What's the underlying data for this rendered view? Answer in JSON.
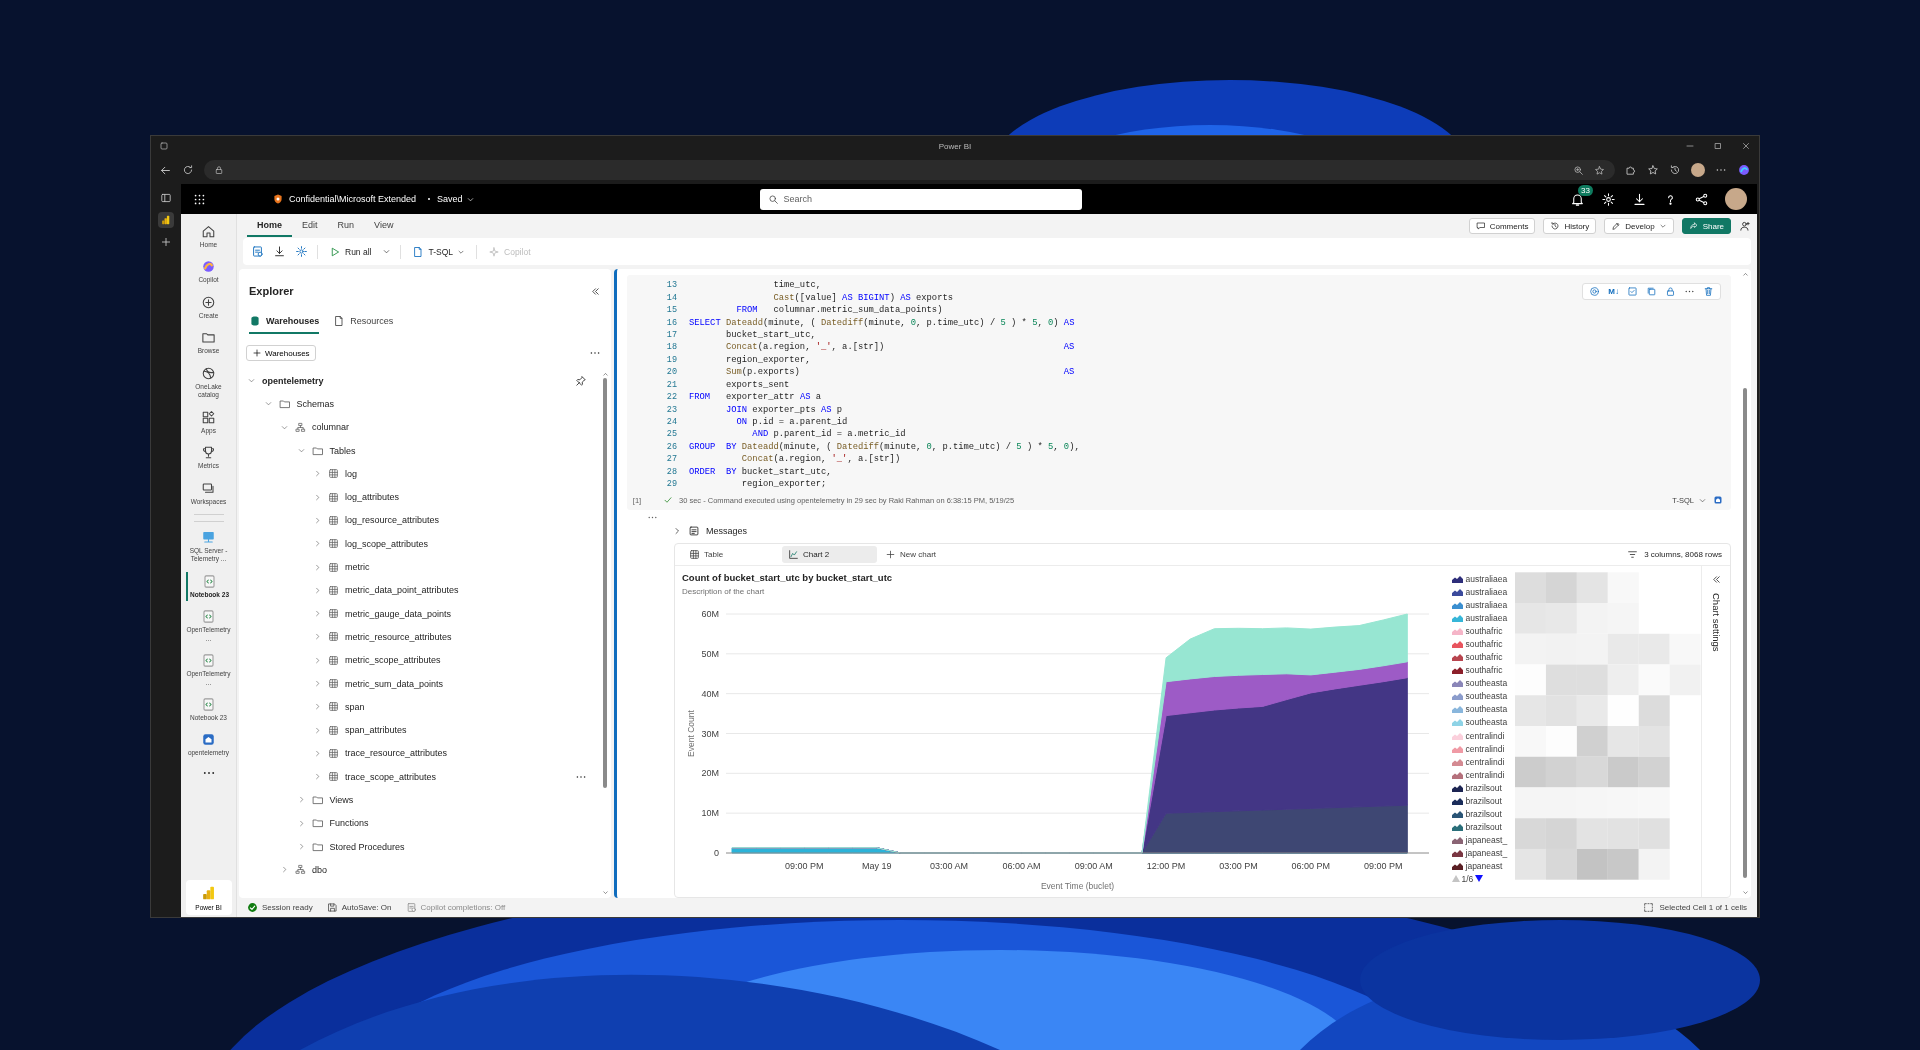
{
  "browser": {
    "title": "Power BI"
  },
  "app_header": {
    "breadcrumb": "Confidential\\Microsoft Extended",
    "save_state": "Saved",
    "search": {
      "placeholder": "Search"
    },
    "notification_count": "33"
  },
  "nav_rail": [
    {
      "label": "Home",
      "selected": false
    },
    {
      "label": "Copilot",
      "selected": false
    },
    {
      "label": "Create",
      "selected": false
    },
    {
      "label": "Browse",
      "selected": false
    },
    {
      "label": "OneLake catalog",
      "selected": false
    },
    {
      "label": "Apps",
      "selected": false
    },
    {
      "label": "Metrics",
      "selected": false
    },
    {
      "label": "Workspaces",
      "selected": false
    },
    {
      "label": "SQL Server - Telemetry ...",
      "selected": false
    },
    {
      "label": "Notebook 23",
      "selected": true
    },
    {
      "label": "OpenTelemetry ...",
      "selected": false
    },
    {
      "label": "OpenTelemetry ...",
      "selected": false
    },
    {
      "label": "Notebook 23",
      "selected": false
    },
    {
      "label": "opentelemetry",
      "selected": false
    }
  ],
  "workload_switcher": "Power BI",
  "ribbon": {
    "tabs": [
      {
        "label": "Home",
        "selected": true
      },
      {
        "label": "Edit",
        "selected": false
      },
      {
        "label": "Run",
        "selected": false
      },
      {
        "label": "View",
        "selected": false
      }
    ],
    "actions": [
      {
        "label": "Comments",
        "kind": "plain"
      },
      {
        "label": "History",
        "kind": "plain"
      },
      {
        "label": "Develop",
        "kind": "dropdown"
      },
      {
        "label": "Share",
        "kind": "primary"
      }
    ]
  },
  "toolbar": {
    "run_all": "Run all",
    "language": "T-SQL",
    "copilot": {
      "label": "Copilot",
      "disabled": true
    }
  },
  "explorer": {
    "title": "Explorer",
    "tabs": [
      {
        "label": "Warehouses",
        "selected": true
      },
      {
        "label": "Resources",
        "selected": false
      }
    ],
    "add_button": "Warehouses",
    "tree": [
      {
        "label": "opentelemetry",
        "kind": "database",
        "expanded": true,
        "children": [
          {
            "label": "Schemas",
            "kind": "folder",
            "expanded": true,
            "children": [
              {
                "label": "columnar",
                "kind": "schema",
                "expanded": true,
                "children": [
                  {
                    "label": "Tables",
                    "kind": "folder",
                    "expanded": true,
                    "children": [
                      {
                        "label": "log",
                        "kind": "table",
                        "expanded": false,
                        "hovered": false
                      },
                      {
                        "label": "log_attributes",
                        "kind": "table",
                        "expanded": false,
                        "hovered": false
                      },
                      {
                        "label": "log_resource_attributes",
                        "kind": "table",
                        "expanded": false,
                        "hovered": false
                      },
                      {
                        "label": "log_scope_attributes",
                        "kind": "table",
                        "expanded": false,
                        "hovered": false
                      },
                      {
                        "label": "metric",
                        "kind": "table",
                        "expanded": false,
                        "hovered": false
                      },
                      {
                        "label": "metric_data_point_attributes",
                        "kind": "table",
                        "expanded": false,
                        "hovered": false
                      },
                      {
                        "label": "metric_gauge_data_points",
                        "kind": "table",
                        "expanded": false,
                        "hovered": false
                      },
                      {
                        "label": "metric_resource_attributes",
                        "kind": "table",
                        "expanded": false,
                        "hovered": false
                      },
                      {
                        "label": "metric_scope_attributes",
                        "kind": "table",
                        "expanded": false,
                        "hovered": false
                      },
                      {
                        "label": "metric_sum_data_points",
                        "kind": "table",
                        "expanded": false,
                        "hovered": false
                      },
                      {
                        "label": "span",
                        "kind": "table",
                        "expanded": false,
                        "hovered": false
                      },
                      {
                        "label": "span_attributes",
                        "kind": "table",
                        "expanded": false,
                        "hovered": false
                      },
                      {
                        "label": "trace_resource_attributes",
                        "kind": "table",
                        "expanded": false,
                        "hovered": false
                      },
                      {
                        "label": "trace_scope_attributes",
                        "kind": "table",
                        "expanded": false,
                        "hovered": true
                      }
                    ]
                  },
                  {
                    "label": "Views",
                    "kind": "folder",
                    "expanded": false
                  },
                  {
                    "label": "Functions",
                    "kind": "folder",
                    "expanded": false
                  },
                  {
                    "label": "Stored Procedures",
                    "kind": "folder",
                    "expanded": false
                  }
                ]
              },
              {
                "label": "dbo",
                "kind": "schema",
                "expanded": false
              }
            ]
          }
        ]
      }
    ]
  },
  "cell": {
    "execution_count": "[1]",
    "toolbar_label": "M↓",
    "lines": [
      {
        "number": "13",
        "tokens": [
          {
            "text": "                time_utc,",
            "kind": "plain"
          }
        ]
      },
      {
        "number": "14",
        "tokens": [
          {
            "text": "                Cast",
            "kind": "function"
          },
          {
            "text": "([value] ",
            "kind": "plain"
          },
          {
            "text": "AS BIGINT",
            "kind": "keyword"
          },
          {
            "text": ") ",
            "kind": "plain"
          },
          {
            "text": "AS",
            "kind": "keyword"
          },
          {
            "text": " exports",
            "kind": "plain"
          }
        ]
      },
      {
        "number": "15",
        "tokens": [
          {
            "text": "         FROM",
            "kind": "keyword"
          },
          {
            "text": "   columnar.metric_sum_data_points)",
            "kind": "plain"
          }
        ]
      },
      {
        "number": "16",
        "tokens": [
          {
            "text": "SELECT ",
            "kind": "keyword"
          },
          {
            "text": "Dateadd",
            "kind": "function"
          },
          {
            "text": "(minute, ( ",
            "kind": "plain"
          },
          {
            "text": "Datediff",
            "kind": "function"
          },
          {
            "text": "(minute, ",
            "kind": "plain"
          },
          {
            "text": "0",
            "kind": "number"
          },
          {
            "text": ", p.time_utc) / ",
            "kind": "plain"
          },
          {
            "text": "5",
            "kind": "number"
          },
          {
            "text": " ) * ",
            "kind": "plain"
          },
          {
            "text": "5",
            "kind": "number"
          },
          {
            "text": ", ",
            "kind": "plain"
          },
          {
            "text": "0",
            "kind": "number"
          },
          {
            "text": ") ",
            "kind": "plain"
          },
          {
            "text": "AS",
            "kind": "keyword"
          }
        ]
      },
      {
        "number": "17",
        "tokens": [
          {
            "text": "       bucket_start_utc,",
            "kind": "plain"
          }
        ]
      },
      {
        "number": "18",
        "tokens": [
          {
            "text": "       Concat",
            "kind": "function"
          },
          {
            "text": "(a.region, ",
            "kind": "plain"
          },
          {
            "text": "'_'",
            "kind": "string"
          },
          {
            "text": ", a.[str])                                  ",
            "kind": "plain"
          },
          {
            "text": "AS",
            "kind": "keyword"
          }
        ]
      },
      {
        "number": "19",
        "tokens": [
          {
            "text": "       region_exporter,",
            "kind": "plain"
          }
        ]
      },
      {
        "number": "20",
        "tokens": [
          {
            "text": "       Sum",
            "kind": "function"
          },
          {
            "text": "(p.exports)                                                  ",
            "kind": "plain"
          },
          {
            "text": "AS",
            "kind": "keyword"
          }
        ]
      },
      {
        "number": "21",
        "tokens": [
          {
            "text": "       exports_sent",
            "kind": "plain"
          }
        ]
      },
      {
        "number": "22",
        "tokens": [
          {
            "text": "FROM",
            "kind": "keyword"
          },
          {
            "text": "   exporter_attr ",
            "kind": "plain"
          },
          {
            "text": "AS",
            "kind": "keyword"
          },
          {
            "text": " a",
            "kind": "plain"
          }
        ]
      },
      {
        "number": "23",
        "tokens": [
          {
            "text": "       JOIN",
            "kind": "keyword"
          },
          {
            "text": " exporter_pts ",
            "kind": "plain"
          },
          {
            "text": "AS",
            "kind": "keyword"
          },
          {
            "text": " p",
            "kind": "plain"
          }
        ]
      },
      {
        "number": "24",
        "tokens": [
          {
            "text": "         ON",
            "kind": "keyword"
          },
          {
            "text": " p.id = a.parent_id",
            "kind": "plain"
          }
        ]
      },
      {
        "number": "25",
        "tokens": [
          {
            "text": "            AND",
            "kind": "keyword"
          },
          {
            "text": " p.parent_id = a.metric_id",
            "kind": "plain"
          }
        ]
      },
      {
        "number": "26",
        "tokens": [
          {
            "text": "GROUP  BY ",
            "kind": "keyword"
          },
          {
            "text": "Dateadd",
            "kind": "function"
          },
          {
            "text": "(minute, ( ",
            "kind": "plain"
          },
          {
            "text": "Datediff",
            "kind": "function"
          },
          {
            "text": "(minute, ",
            "kind": "plain"
          },
          {
            "text": "0",
            "kind": "number"
          },
          {
            "text": ", p.time_utc) / ",
            "kind": "plain"
          },
          {
            "text": "5",
            "kind": "number"
          },
          {
            "text": " ) * ",
            "kind": "plain"
          },
          {
            "text": "5",
            "kind": "number"
          },
          {
            "text": ", ",
            "kind": "plain"
          },
          {
            "text": "0",
            "kind": "number"
          },
          {
            "text": "),",
            "kind": "plain"
          }
        ]
      },
      {
        "number": "27",
        "tokens": [
          {
            "text": "          Concat",
            "kind": "function"
          },
          {
            "text": "(a.region, ",
            "kind": "plain"
          },
          {
            "text": "'_'",
            "kind": "string"
          },
          {
            "text": ", a.[str])",
            "kind": "plain"
          }
        ]
      },
      {
        "number": "28",
        "tokens": [
          {
            "text": "ORDER  BY ",
            "kind": "keyword"
          },
          {
            "text": "bucket_start_utc,",
            "kind": "plain"
          }
        ]
      },
      {
        "number": "29",
        "tokens": [
          {
            "text": "          region_exporter;",
            "kind": "plain"
          }
        ]
      }
    ],
    "status": "30 sec - Command executed using opentelemetry in 29 sec by Raki Rahman on 6:38:15 PM, 5/19/25",
    "language": "T-SQL"
  },
  "output": {
    "messages": "Messages",
    "tabs": [
      {
        "label": "Table",
        "selected": false
      },
      {
        "label": "Chart 2",
        "selected": true
      }
    ],
    "new_chart": "New chart",
    "summary": "3 columns, 8068 rows",
    "chart": {
      "title": "Count of bucket_start_utc by bucket_start_utc",
      "description": "Description of the chart",
      "settings_label": "Chart settings",
      "legend_page": "1/6",
      "legend": [
        {
          "label": "australiaea",
          "color": "#2e2e7a"
        },
        {
          "label": "australiaea",
          "color": "#3b4a9c"
        },
        {
          "label": "australiaea",
          "color": "#3b8fd0"
        },
        {
          "label": "australiaea",
          "color": "#36b6d8"
        },
        {
          "label": "southafric",
          "color": "#f5b5c8"
        },
        {
          "label": "southafric",
          "color": "#e8545e"
        },
        {
          "label": "southafric",
          "color": "#b8454f"
        },
        {
          "label": "southafric",
          "color": "#8c1f2a"
        },
        {
          "label": "southeasta",
          "color": "#8a86b8"
        },
        {
          "label": "southeasta",
          "color": "#8b9ccc"
        },
        {
          "label": "southeasta",
          "color": "#89b6dc"
        },
        {
          "label": "southeasta",
          "color": "#8ed3e6"
        },
        {
          "label": "centralindi",
          "color": "#fbd0dc"
        },
        {
          "label": "centralindi",
          "color": "#f09aa5"
        },
        {
          "label": "centralindi",
          "color": "#d48a92"
        },
        {
          "label": "centralindi",
          "color": "#b5717c"
        },
        {
          "label": "brazilsout",
          "color": "#1c2452"
        },
        {
          "label": "brazilsout",
          "color": "#1a2d5a"
        },
        {
          "label": "brazilsout",
          "color": "#2a5576"
        },
        {
          "label": "brazilsout",
          "color": "#2a6f7a"
        },
        {
          "label": "japaneast_",
          "color": "#8a6474"
        },
        {
          "label": "japaneast_",
          "color": "#7a3642"
        },
        {
          "label": "japaneast",
          "color": "#5a1f24"
        }
      ],
      "chart_data": {
        "type": "area",
        "stacked": true,
        "grid": true,
        "xlabel": "Event Time (buclet)",
        "ylabel": "Event Count",
        "categories": [
          null,
          null,
          null,
          "09:00 PM",
          null,
          null,
          "May 19",
          null,
          null,
          "03:00 AM",
          null,
          null,
          "06:00 AM",
          null,
          null,
          "09:00 AM",
          null,
          null,
          "12:00 PM",
          null,
          null,
          "03:00 PM",
          null,
          null,
          "06:00 PM",
          null,
          null,
          "09:00 PM",
          null
        ],
        "ylim": [
          0,
          60000000
        ],
        "yticks": [
          {
            "value": 0,
            "label": "0"
          },
          {
            "value": 10000000,
            "label": "10M"
          },
          {
            "value": 20000000,
            "label": "20M"
          },
          {
            "value": 30000000,
            "label": "30M"
          },
          {
            "value": 40000000,
            "label": "40M"
          },
          {
            "value": 50000000,
            "label": "50M"
          },
          {
            "value": 60000000,
            "label": "60M"
          }
        ],
        "series": [
          {
            "color": "#2bb3d9",
            "values": [
              1300000,
              1300000,
              1300000,
              1300000,
              1300000,
              1300000,
              1300000,
              0,
              0,
              0,
              0,
              0,
              0,
              0,
              0,
              0,
              0,
              0,
              0,
              0,
              0,
              0,
              0,
              0,
              0,
              0,
              0,
              0,
              0
            ]
          },
          {
            "color": "#3e4773",
            "values": [
              0,
              0,
              0,
              0,
              0,
              0,
              0,
              0,
              0,
              0,
              0,
              0,
              0,
              0,
              0,
              0,
              0,
              0,
              10000000,
              10200000,
              10400000,
              10600000,
              10800000,
              11000000,
              11200000,
              11400000,
              11600000,
              11800000,
              12000000
            ]
          },
          {
            "color": "#433685",
            "values": [
              0,
              0,
              0,
              0,
              0,
              0,
              0,
              0,
              0,
              0,
              0,
              0,
              0,
              0,
              0,
              0,
              0,
              0,
              24500000,
              25000000,
              25500000,
              25800000,
              26000000,
              27500000,
              29000000,
              29800000,
              30500000,
              31200000,
              32000000
            ]
          },
          {
            "color": "#9d5bc6",
            "values": [
              0,
              0,
              0,
              0,
              0,
              0,
              0,
              0,
              0,
              0,
              0,
              0,
              0,
              0,
              0,
              0,
              0,
              0,
              8500000,
              8500000,
              8400000,
              8200000,
              8000000,
              6500000,
              4500000,
              4200000,
              4000000,
              4000000,
              4000000
            ]
          },
          {
            "color": "#97e6d2",
            "values": [
              0,
              0,
              0,
              0,
              0,
              0,
              0,
              0,
              0,
              0,
              0,
              0,
              0,
              0,
              0,
              0,
              0,
              0,
              6000000,
              10000000,
              12000000,
              11800000,
              11500000,
              11500000,
              11500000,
              11300000,
              11000000,
              11500000,
              12000000
            ]
          }
        ]
      }
    }
  },
  "status_bar": {
    "items": [
      {
        "label": "Session ready",
        "kind": "session",
        "disabled": false
      },
      {
        "label": "AutoSave: On",
        "kind": "autosave",
        "disabled": false
      },
      {
        "label": "Copilot completions: Off",
        "kind": "copilot",
        "disabled": true
      }
    ],
    "selection": "Selected Cell 1 of 1 cells"
  }
}
